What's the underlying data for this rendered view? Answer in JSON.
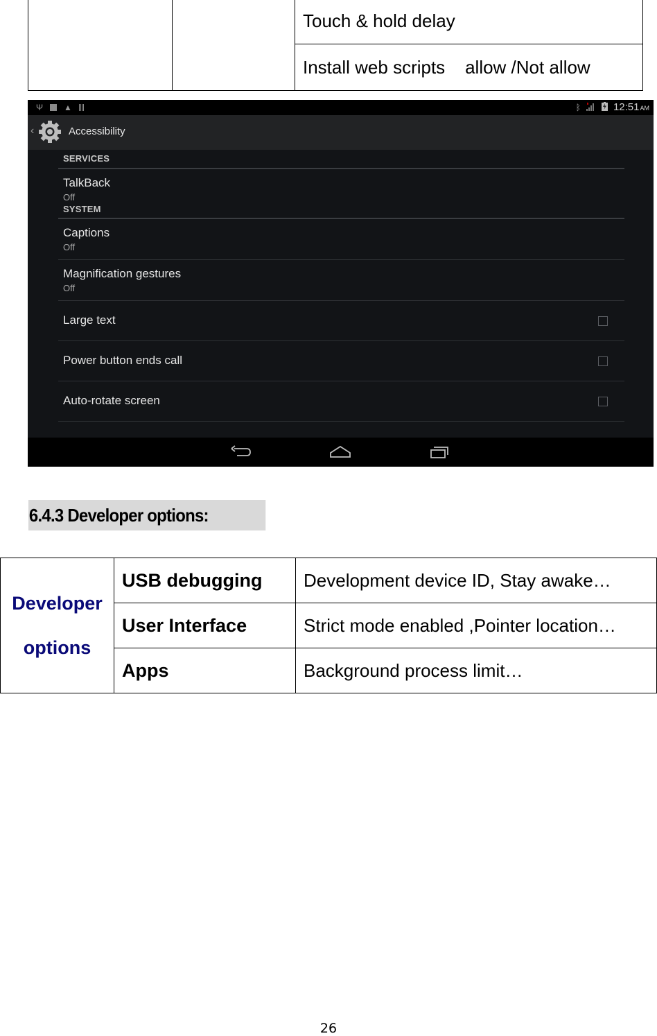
{
  "top_table": {
    "rows": [
      {
        "col1": "",
        "col2": "",
        "col3": "Touch & hold delay"
      },
      {
        "col1": "",
        "col2": "",
        "col3": "Install web scripts    allow /Not allow"
      }
    ]
  },
  "screenshot": {
    "status_bar": {
      "left_icons": [
        "usb-icon",
        "image-notification-icon",
        "warning-icon",
        "storage-icon"
      ],
      "right_icons": [
        "bluetooth-icon",
        "signal-icon",
        "battery-charging-icon"
      ],
      "time": "12:51",
      "ampm": "AM"
    },
    "action_bar": {
      "back_icon": "chevron-left-icon",
      "app_icon": "settings-gear-icon",
      "title": "Accessibility"
    },
    "sections": [
      {
        "header": "SERVICES",
        "items": [
          {
            "title": "TalkBack",
            "summary": "Off"
          }
        ]
      },
      {
        "header": "SYSTEM",
        "items": [
          {
            "title": "Captions",
            "summary": "Off"
          },
          {
            "title": "Magnification gestures",
            "summary": "Off"
          },
          {
            "title": "Large text",
            "checked": false
          },
          {
            "title": "Power button ends call",
            "checked": false
          },
          {
            "title": "Auto-rotate screen",
            "checked": false
          }
        ]
      }
    ],
    "nav_bar": {
      "buttons": [
        "back-icon",
        "home-icon",
        "recent-apps-icon"
      ]
    },
    "colors": {
      "background": "#121417",
      "action_bar": "#222325",
      "status_bar": "#000000",
      "text_primary": "#e6e6e6",
      "text_secondary": "#a8a8a8"
    }
  },
  "section_heading": "6.4.3 Developer options:",
  "dev_table": {
    "header": "Developer options",
    "header_line1": "Developer",
    "header_line2": "options",
    "header_color": "#0a0a78",
    "rows": [
      {
        "key": "USB debugging",
        "value": "Development device ID, Stay awake…"
      },
      {
        "key": "User Interface",
        "value": "Strict mode enabled ,Pointer location…"
      },
      {
        "key": "Apps",
        "value": "Background process limit…"
      }
    ]
  },
  "page_number": "26"
}
